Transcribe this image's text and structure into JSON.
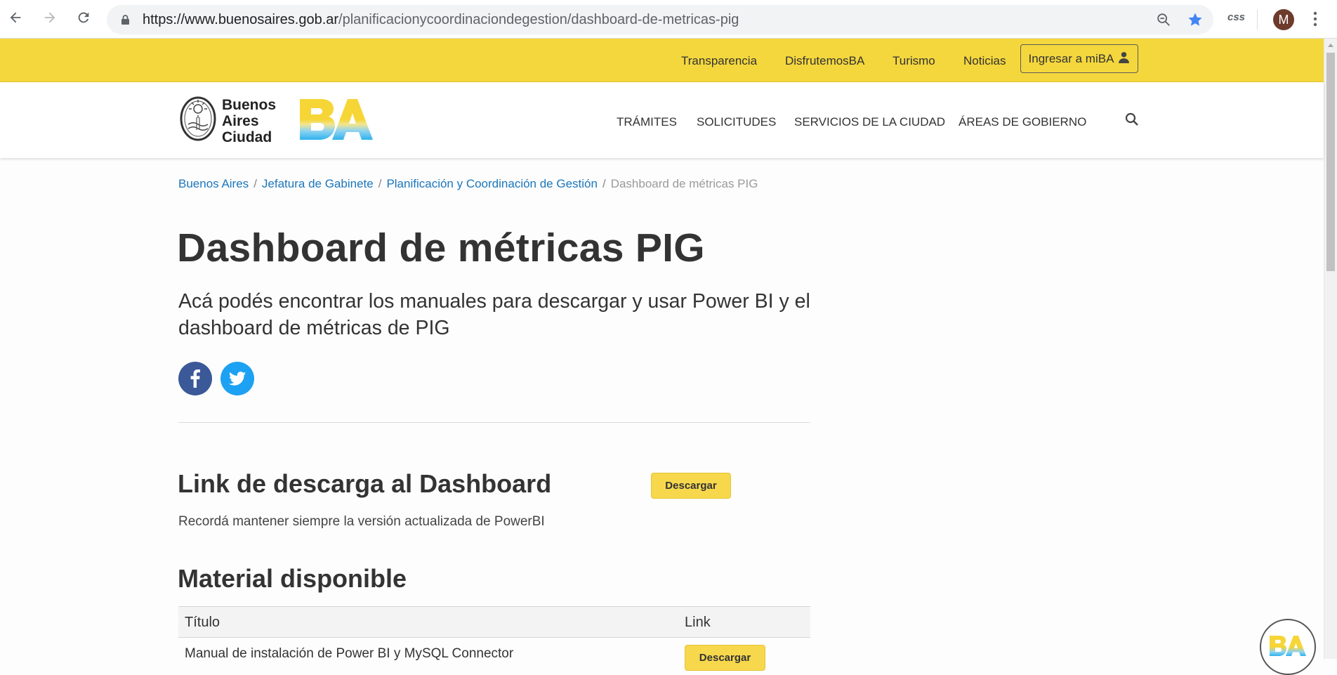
{
  "browser": {
    "url_host": "https://www.buenosaires.gob.ar",
    "url_path": "/planificacionycoordinaciondegestion/dashboard-de-metricas-pig",
    "extension_label": "css",
    "profile_initial": "M",
    "icons": [
      "back-arrow-icon",
      "forward-arrow-icon",
      "reload-icon",
      "lock-icon",
      "zoom-icon",
      "star-icon",
      "kebab-menu-icon"
    ],
    "colors": {
      "star": "#4285f4",
      "avatar": "#6d3b2c"
    }
  },
  "topbar": {
    "links": [
      "Transparencia",
      "DisfrutemosBA",
      "Turismo",
      "Noticias"
    ],
    "login_label": "Ingresar a miBA",
    "color": "#f4d73d"
  },
  "header": {
    "logo_lines": [
      "Buenos",
      "Aires",
      "Ciudad"
    ],
    "logo_mark": "BA",
    "nav": [
      "TRÁMITES",
      "SOLICITUDES",
      "SERVICIOS DE LA CIUDAD",
      "ÁREAS DE GOBIERNO"
    ]
  },
  "breadcrumb": {
    "items": [
      "Buenos Aires",
      "Jefatura de Gabinete",
      "Planificación y Coordinación de Gestión"
    ],
    "current": "Dashboard de métricas PIG"
  },
  "page": {
    "title": "Dashboard de métricas PIG",
    "subtitle": "Acá podés encontrar los manuales para descargar y usar Power BI y el dashboard de métricas de PIG",
    "share": [
      "facebook-icon",
      "twitter-icon"
    ]
  },
  "download_section": {
    "heading": "Link de descarga al Dashboard",
    "button_label": "Descargar",
    "note": "Recordá mantener siempre la versión actualizada de PowerBI"
  },
  "material": {
    "heading": "Material disponible",
    "columns": [
      "Título",
      "Link"
    ],
    "rows": [
      {
        "title": "Manual de instalación de Power BI y MySQL Connector",
        "link_label": "Descargar"
      }
    ]
  }
}
